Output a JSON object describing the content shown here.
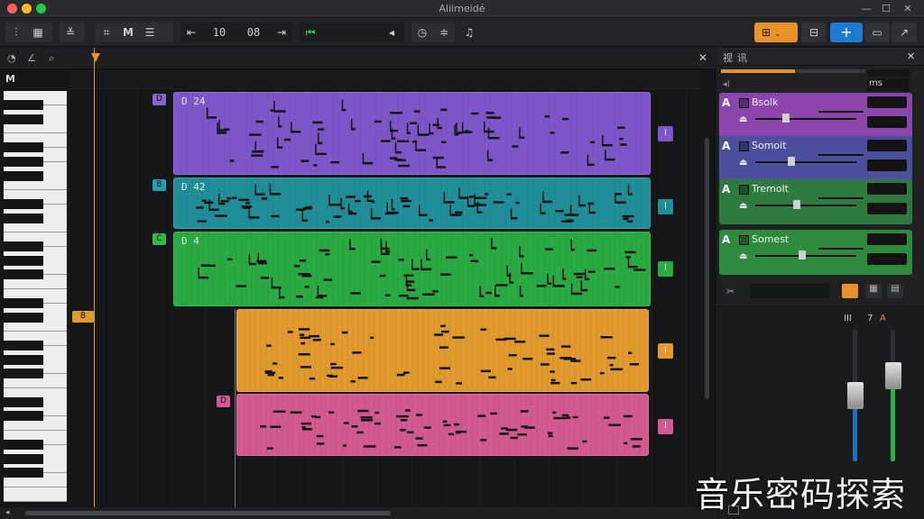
{
  "window": {
    "title": "Aliimeidé"
  },
  "toolbar": {
    "lcd_position": "10",
    "lcd_beats": "08",
    "midi_label": "M"
  },
  "arrange": {
    "piano_label": "M",
    "regions": [
      {
        "name": "D 24",
        "tag": "D",
        "color": "#7d57c9",
        "end_icon": "I"
      },
      {
        "name": "D 42",
        "tag": "B",
        "color": "#1f8e98",
        "end_icon": "I"
      },
      {
        "name": "D 4",
        "tag": "C",
        "color": "#2aaa43",
        "end_icon": "I"
      },
      {
        "name": "",
        "tag": "B",
        "color": "#e09a2e",
        "end_icon": "I"
      },
      {
        "name": "",
        "tag": "D",
        "color": "#d25a90",
        "end_icon": "I"
      }
    ]
  },
  "inspector": {
    "tabs": [
      "视",
      "讯"
    ],
    "top_label": "ms",
    "tracks": [
      {
        "name": "Bsolk",
        "color": "#8b45ad",
        "letter": "A"
      },
      {
        "name": "Somoit",
        "color": "#4b4f9e",
        "letter": "A"
      },
      {
        "name": "Tremolt",
        "color": "#2f7a3f",
        "letter": "A"
      },
      {
        "name": "Somest",
        "color": "#2d8b3b",
        "letter": "A"
      }
    ],
    "mixer_labels": [
      "III",
      "7",
      "A"
    ]
  },
  "watermark": "音乐密码探索",
  "colors": {
    "accent_orange": "#e8932a",
    "accent_blue": "#1f7ad3"
  }
}
